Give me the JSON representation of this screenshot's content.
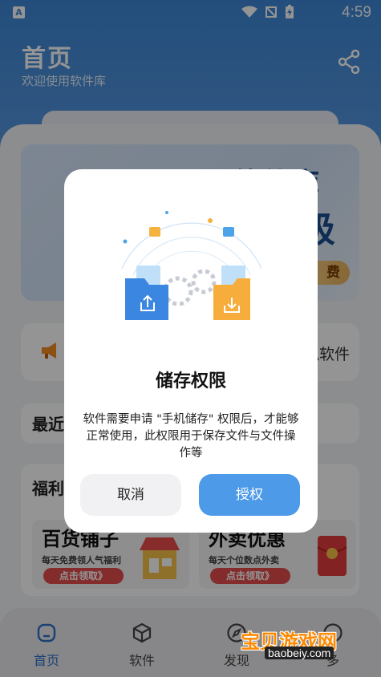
{
  "status_bar": {
    "app_badge": "A",
    "time": "4:59"
  },
  "header": {
    "title": "首页",
    "subtitle": "欢迎使用软件库"
  },
  "banner": {
    "top_text": "软件库",
    "big_text": "极",
    "pill_text": "费"
  },
  "notice": {
    "text": "拟软件"
  },
  "recent": {
    "title": "最近"
  },
  "welfare": {
    "title": "福利",
    "promos": [
      {
        "name": "百货铺子",
        "desc": "每天免费领人气福利",
        "button": "点击领取》"
      },
      {
        "name": "外卖优惠",
        "desc": "每天个位数点外卖",
        "button": "点击领取》"
      }
    ]
  },
  "bottom_nav": [
    {
      "label": "首页",
      "icon": "home-icon",
      "active": true
    },
    {
      "label": "软件",
      "icon": "box-icon"
    },
    {
      "label": "发现",
      "icon": "compass-icon"
    },
    {
      "label": "多",
      "icon": "more-icon"
    }
  ],
  "dialog": {
    "title": "储存权限",
    "body": "软件需要申请 \"手机储存\" 权限后，才能够正常使用，此权限用于保存文件与文件操作等",
    "cancel": "取消",
    "confirm": "授权"
  },
  "watermark": {
    "text": "宝贝游戏网",
    "url": "baobeiy.com"
  },
  "colors": {
    "header_blue": "#3d86d6",
    "confirm_blue": "#4d9ae8",
    "promo_red": "#e34a4a"
  }
}
